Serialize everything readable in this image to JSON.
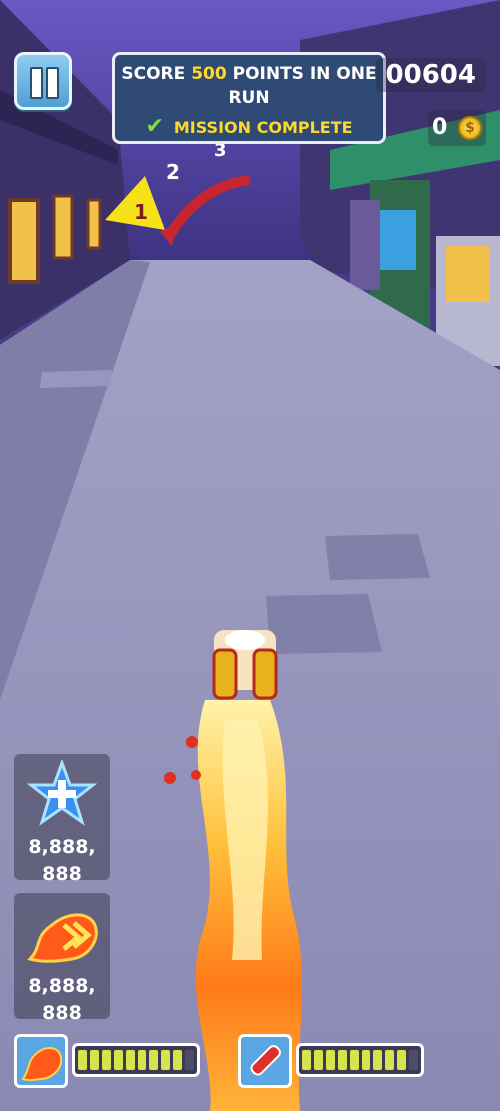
{
  "hud": {
    "score": "00604",
    "coins": "0",
    "coin_symbol": "$"
  },
  "mission": {
    "line1_pre": "SCORE",
    "line1_highlight": "500",
    "line1_post": "POINTS IN ONE",
    "line2": "RUN",
    "status": "MISSION COMPLETE"
  },
  "track_markers": [
    "1",
    "2",
    "3"
  ],
  "items": {
    "shield_count": "8,888,\n888",
    "boost_count": "8,888,\n888"
  },
  "meters": {
    "jetpack_fill": 0.9,
    "skateboard_fill": 0.9
  },
  "colors": {
    "sky": "#5a4aa8",
    "street": "#8e8db8",
    "accent_yellow": "#ffd928",
    "mission_bg": "#2f4a74"
  }
}
